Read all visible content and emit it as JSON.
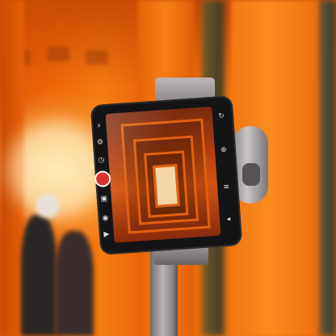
{
  "scene": {
    "subject": "smartphone-on-gimbal",
    "setting": "torii-gate-corridor",
    "accent_colors": {
      "torii_orange": "#f06a08",
      "gimbal_gray": "#9a9495",
      "phone_black": "#141416",
      "record_red": "#e03030"
    }
  },
  "icons": {
    "left": [
      "flash-icon",
      "settings-icon",
      "record-button",
      "gallery-icon"
    ],
    "right": [
      "camera-switch-icon",
      "mode-icon",
      "zoom-icon",
      "menu-icon"
    ]
  }
}
